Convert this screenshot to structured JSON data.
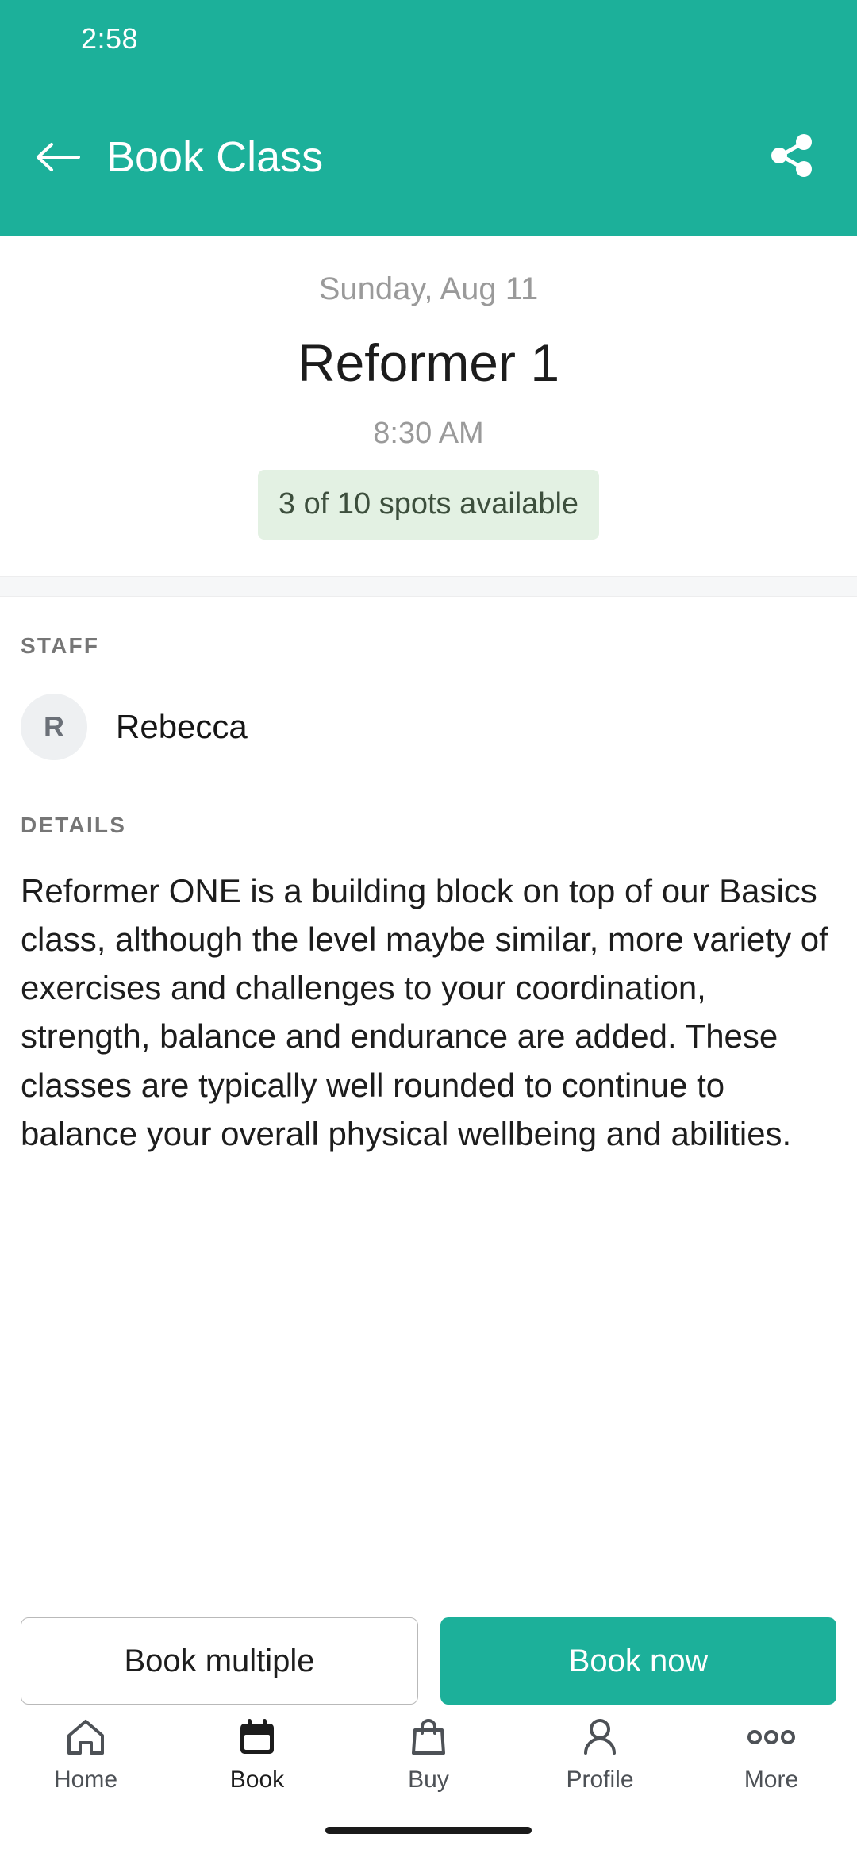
{
  "theme": {
    "accent": "#1CB09A",
    "badge_bg": "#e3f1e3",
    "badge_text": "#3d4f3d",
    "muted_text": "#9a9a9a"
  },
  "status_bar": {
    "time": "2:58"
  },
  "app_bar": {
    "title": "Book Class",
    "back_icon": "arrow-left-icon",
    "share_icon": "share-icon"
  },
  "hero": {
    "date": "Sunday, Aug 11",
    "class_name": "Reformer 1",
    "time": "8:30 AM",
    "spots_badge": "3 of 10 spots available",
    "spots_available": 3,
    "spots_total": 10
  },
  "staff": {
    "label": "STAFF",
    "members": [
      {
        "initial": "R",
        "name": "Rebecca"
      }
    ]
  },
  "details": {
    "label": "DETAILS",
    "text": "Reformer ONE is a building block on top of our Basics class, although the level maybe similar, more variety of exercises and challenges to your coordination, strength, balance and endurance are added. These classes are typically well rounded to continue to balance your overall physical wellbeing and abilities."
  },
  "actions": {
    "secondary_label": "Book multiple",
    "primary_label": "Book now"
  },
  "bottom_nav": {
    "active_index": 1,
    "items": [
      {
        "label": "Home",
        "icon": "home-icon"
      },
      {
        "label": "Book",
        "icon": "calendar-icon"
      },
      {
        "label": "Buy",
        "icon": "shopping-bag-icon"
      },
      {
        "label": "Profile",
        "icon": "person-icon"
      },
      {
        "label": "More",
        "icon": "more-horizontal-icon"
      }
    ]
  }
}
